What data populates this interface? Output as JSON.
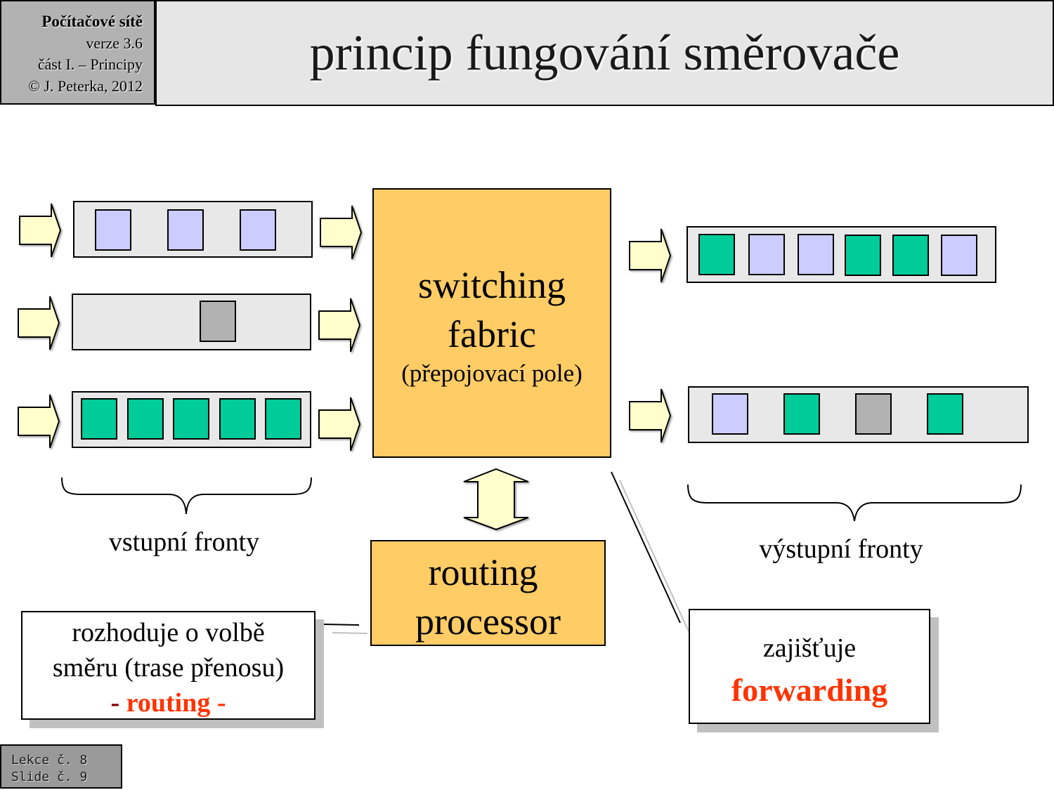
{
  "header": {
    "course": "Počítačové sítě",
    "version": "verze 3.6",
    "part": "část I.  –  Principy",
    "copyright": "© J. Peterka, 2012"
  },
  "title": "princip fungování směrovače",
  "footer": {
    "lesson": "Lekce č. 8",
    "slide": "Slide č. 9"
  },
  "colors": {
    "packet_lavender": "#ccccff",
    "packet_green": "#00cc99",
    "packet_gray": "#b2b2b2",
    "queue_bg": "#e8e8e8",
    "arrow_fill": "#ffffcc",
    "box_orange": "#ffcc66",
    "accent_red": "#ff3300"
  },
  "input_queues": [
    {
      "packets": [
        "lavender",
        "lavender",
        "lavender"
      ]
    },
    {
      "packets": [
        "gray"
      ]
    },
    {
      "packets": [
        "green",
        "green",
        "green",
        "green",
        "green"
      ]
    }
  ],
  "output_queues": [
    {
      "packets": [
        "green",
        "lavender",
        "lavender",
        "green",
        "green",
        "lavender"
      ]
    },
    {
      "packets": [
        "lavender",
        "green",
        "gray",
        "green"
      ]
    }
  ],
  "switching_fabric": {
    "line1": "switching",
    "line2": "fabric",
    "subtitle": "(přepojovací pole)"
  },
  "routing_processor": {
    "line1": "routing",
    "line2": "processor"
  },
  "labels": {
    "input_queues": "vstupní fronty",
    "output_queues": "výstupní fronty"
  },
  "routing_callout": {
    "line1": "rozhoduje o volbě",
    "line2": "směru (trase přenosu)",
    "dash_left": "- ",
    "keyword": "routing",
    "dash_right": " -"
  },
  "forwarding_callout": {
    "line1": "zajišťuje",
    "keyword": "forwarding"
  }
}
